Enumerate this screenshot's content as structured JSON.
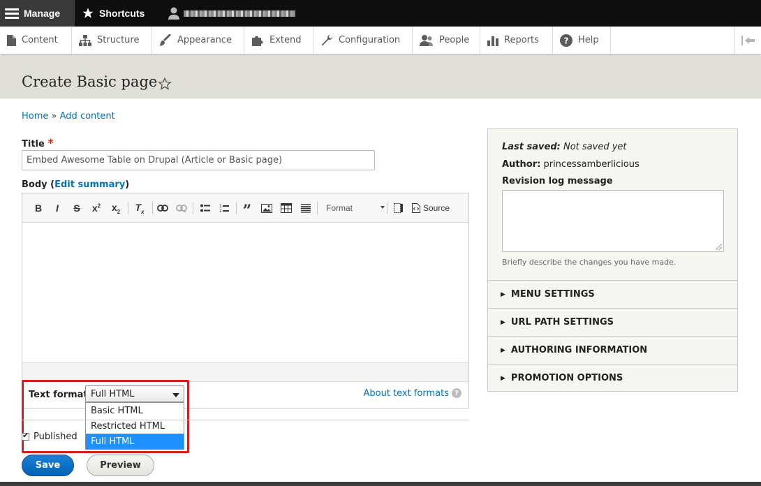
{
  "topbar": {
    "manage_label": "Manage",
    "shortcuts_label": "Shortcuts"
  },
  "tray": {
    "items": [
      {
        "label": "Content",
        "icon": "document-icon"
      },
      {
        "label": "Structure",
        "icon": "sitemap-icon"
      },
      {
        "label": "Appearance",
        "icon": "brush-icon"
      },
      {
        "label": "Extend",
        "icon": "puzzle-icon"
      },
      {
        "label": "Configuration",
        "icon": "wrench-icon"
      },
      {
        "label": "People",
        "icon": "people-icon"
      },
      {
        "label": "Reports",
        "icon": "bar-chart-icon"
      },
      {
        "label": "Help",
        "icon": "help-icon"
      }
    ]
  },
  "page": {
    "title": "Create Basic page"
  },
  "breadcrumb": {
    "home": "Home",
    "separator": "»",
    "add_content": "Add content"
  },
  "form": {
    "title_label": "Title",
    "required_mark": "*",
    "title_value": "Embed Awesome Table on Drupal (Article or Basic page)",
    "body_label": "Body",
    "body_paren_open": "(",
    "edit_summary": "Edit summary",
    "body_paren_close": ")",
    "toolbar": {
      "format_label": "Format",
      "source_label": "Source"
    },
    "text_format_label": "Text format",
    "text_format_selected": "Full HTML",
    "text_format_options": [
      "Basic HTML",
      "Restricted HTML",
      "Full HTML"
    ],
    "about_text_formats": "About text formats",
    "help_glyph": "?",
    "published_label": "Published",
    "save_label": "Save",
    "preview_label": "Preview"
  },
  "sidebar": {
    "last_saved_label": "Last saved:",
    "last_saved_value": "Not saved yet",
    "author_label": "Author:",
    "author_value": "princessamberlicious",
    "revision_label": "Revision log message",
    "revision_hint": "Briefly describe the changes you have made.",
    "sections": [
      "MENU SETTINGS",
      "URL PATH SETTINGS",
      "AUTHORING INFORMATION",
      "PROMOTION OPTIONS"
    ]
  },
  "colors": {
    "accent": "#0074bd",
    "save_button": "#0063b5",
    "highlight_box": "#d41f1f",
    "selected_option": "#1e90ff"
  }
}
